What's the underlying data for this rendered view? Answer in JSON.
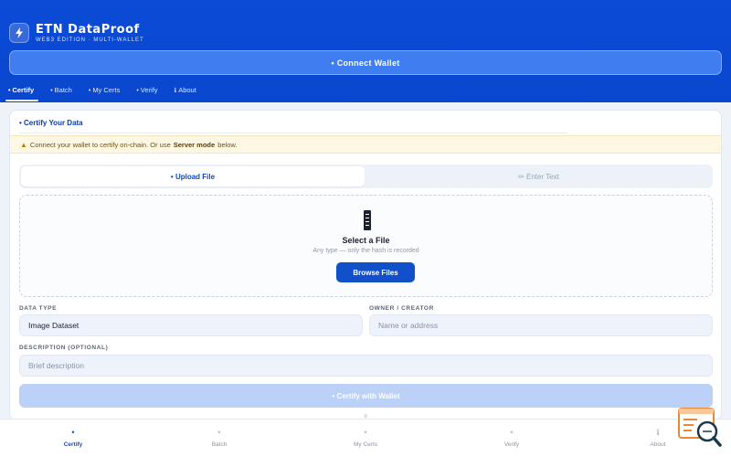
{
  "app": {
    "title": "ETN DataProof",
    "subtitle": "WEB3 EDITION · MULTI-WALLET",
    "connect_label": "• Connect Wallet"
  },
  "tabs": [
    {
      "label": "Certify",
      "active": true
    },
    {
      "label": "Batch",
      "active": false
    },
    {
      "label": "My Certs",
      "active": false
    },
    {
      "label": "Verify",
      "active": false
    },
    {
      "label": "About",
      "active": false
    }
  ],
  "card": {
    "title": "• Certify Your Data",
    "alert": {
      "icon": "warning-icon",
      "text_before": "Connect your wallet to certify on-chain. Or use",
      "bold": "Server mode",
      "text_after": "below."
    },
    "modes": {
      "upload_label": "• Upload File",
      "text_label": "✏ Enter Text"
    },
    "dropzone": {
      "title": "Select a File",
      "subtitle": "Any type — only the hash is recorded",
      "browse_label": "Browse Files"
    },
    "fields": {
      "data_type_label": "DATA TYPE",
      "data_type_value": "Image Dataset",
      "owner_label": "OWNER / CREATOR",
      "owner_placeholder": "Name or address",
      "description_label": "DESCRIPTION (OPTIONAL)",
      "description_placeholder": "Brief description"
    },
    "certify_label": "• Certify with Wallet"
  },
  "bottom_nav": {
    "handle": "≡",
    "items": [
      {
        "label": "Certify",
        "icon": "•",
        "active": true
      },
      {
        "label": "Batch",
        "icon": "•",
        "active": false
      },
      {
        "label": "My Certs",
        "icon": "•",
        "active": false
      },
      {
        "label": "Verify",
        "icon": "•",
        "active": false
      },
      {
        "label": "About",
        "icon": "ℹ",
        "active": false
      }
    ]
  },
  "colors": {
    "brand_blue": "#0b4bd6",
    "primary_button": "#1150c9",
    "disabled_button": "#b8cff8",
    "alert_bg": "#fdf7e3"
  }
}
